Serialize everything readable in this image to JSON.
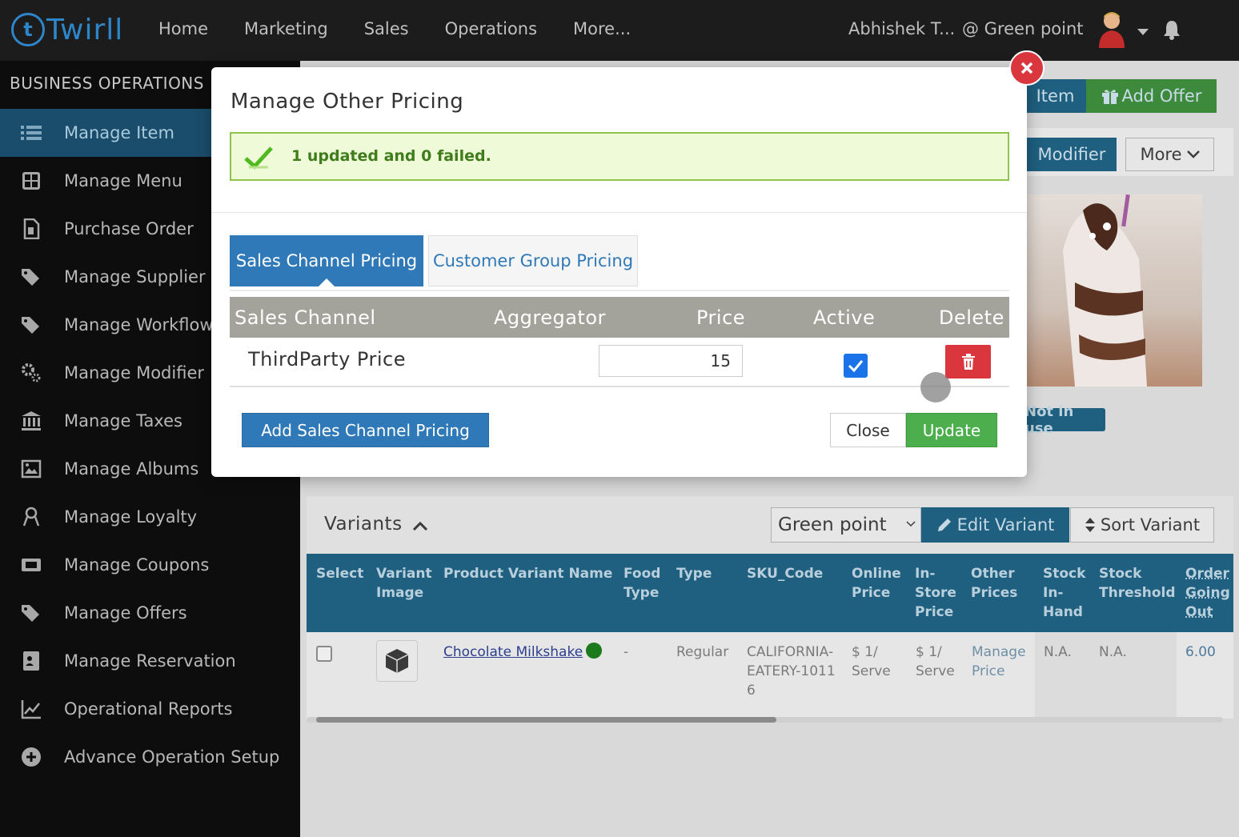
{
  "app": {
    "logo_text": "Twirll",
    "nav": [
      "Home",
      "Marketing",
      "Sales",
      "Operations",
      "More..."
    ],
    "user_name": "Abhishek T...",
    "location": "@ Green point"
  },
  "sidebar": {
    "title": "BUSINESS OPERATIONS",
    "items": [
      {
        "label": "Manage Item",
        "icon": "list-icon",
        "active": true
      },
      {
        "label": "Manage Menu",
        "icon": "grid-icon"
      },
      {
        "label": "Purchase Order",
        "icon": "document-icon"
      },
      {
        "label": "Manage Supplier",
        "icon": "tags-icon"
      },
      {
        "label": "Manage Workflow",
        "icon": "tags-icon"
      },
      {
        "label": "Manage Modifier",
        "icon": "cogs-icon"
      },
      {
        "label": "Manage Taxes",
        "icon": "bank-icon"
      },
      {
        "label": "Manage Albums",
        "icon": "image-icon"
      },
      {
        "label": "Manage Loyalty",
        "icon": "ribbon-icon"
      },
      {
        "label": "Manage Coupons",
        "icon": "ticket-icon"
      },
      {
        "label": "Manage Offers",
        "icon": "tags-icon"
      },
      {
        "label": "Manage Reservation",
        "icon": "contact-card-icon"
      },
      {
        "label": "Operational Reports",
        "icon": "line-chart-icon"
      },
      {
        "label": "Advance Operation Setup",
        "icon": "plus-circle-icon"
      }
    ]
  },
  "background": {
    "add_item_label": "Item",
    "add_offer_label": "Add Offer",
    "modifier_label": "Modifier",
    "more_label": "More",
    "not_in_use_badge": "Not in use",
    "variants": {
      "title": "Variants",
      "location_select": "Green point",
      "edit_variant": "Edit Variant",
      "sort_variant": "Sort Variant",
      "headers": [
        "Select",
        "Variant Image",
        "Product Variant Name",
        "Food Type",
        "Type",
        "SKU_Code",
        "Online Price",
        "In-Store Price",
        "Other Prices",
        "Stock In-Hand",
        "Stock Threshold",
        "Order Going Out"
      ],
      "row": {
        "name": "Chocolate Milkshake",
        "food_type": "-",
        "type": "Regular",
        "sku": "CALIFORNIA-EATERY-10116",
        "online_price": "$ 1/ Serve",
        "instore_price": "$ 1/ Serve",
        "other_prices": "Manage Price",
        "stock_in_hand": "N.A.",
        "stock_threshold": "N.A.",
        "order_going_out": "6.00"
      }
    }
  },
  "modal": {
    "title": "Manage Other Pricing",
    "alert": "1 updated and 0 failed.",
    "tabs": [
      "Sales Channel Pricing",
      "Customer Group Pricing"
    ],
    "table_headers": [
      "Sales Channel",
      "Aggregator",
      "Price",
      "Active",
      "Delete"
    ],
    "rows": [
      {
        "sales_channel": "ThirdParty Price",
        "aggregator": "",
        "price": "15",
        "active": true
      }
    ],
    "add_button": "Add Sales Channel Pricing",
    "close_button": "Close",
    "update_button": "Update"
  },
  "colors": {
    "primary": "#3079b8",
    "success": "#4cae4c",
    "danger": "#d9363e",
    "alert_bg": "#eefad8",
    "header_gray": "#a3a39c"
  }
}
